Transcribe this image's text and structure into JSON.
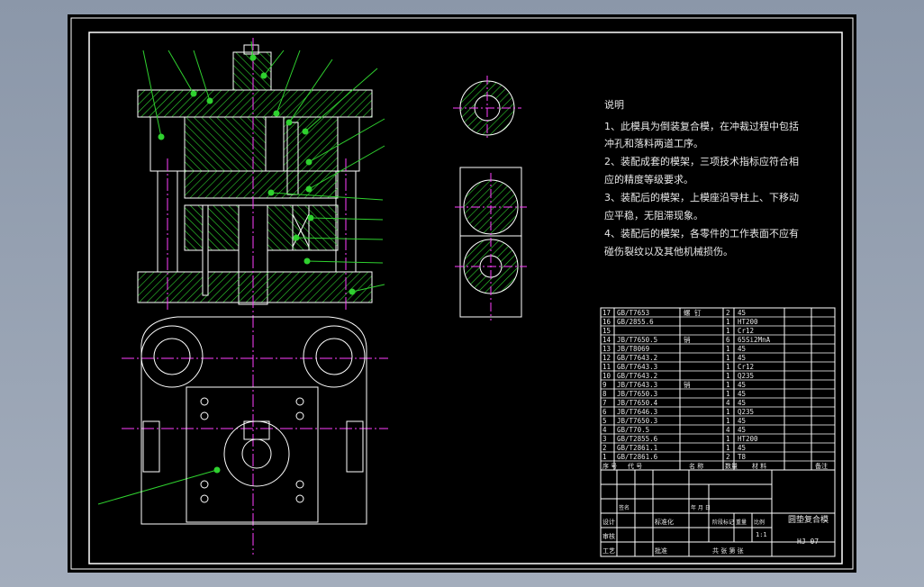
{
  "notes": {
    "heading": "说明",
    "lines": [
      "1、此模具为倒装复合模，在冲裁过程中包括",
      "冲孔和落料两道工序。",
      "2、装配成套的模架，三项技术指标应符合相",
      "应的精度等级要求。",
      "3、装配后的模架，上模座沿导柱上、下移动",
      "应平稳，无阻滞现象。",
      "4、装配后的模架，各零件的工作表面不应有",
      "碰伤裂纹以及其他机械损伤。"
    ]
  },
  "bom": {
    "rows": [
      {
        "no": "17",
        "code": "GB/T7653",
        "name": "螺 钉",
        "qty": "2",
        "mat": "45"
      },
      {
        "no": "16",
        "code": "GB/2855.6",
        "name": "",
        "qty": "1",
        "mat": "HT200"
      },
      {
        "no": "15",
        "code": "",
        "name": "",
        "qty": "1",
        "mat": "Cr12"
      },
      {
        "no": "14",
        "code": "JB/T7650.5",
        "name": "销",
        "qty": "6",
        "mat": "65Si2MnA"
      },
      {
        "no": "13",
        "code": "JB/T8069",
        "name": "",
        "qty": "1",
        "mat": "45"
      },
      {
        "no": "12",
        "code": "GB/T7643.2",
        "name": "",
        "qty": "1",
        "mat": "45"
      },
      {
        "no": "11",
        "code": "GB/T7643.3",
        "name": "",
        "qty": "1",
        "mat": "Cr12"
      },
      {
        "no": "10",
        "code": "GB/T7643.2",
        "name": "",
        "qty": "1",
        "mat": "Q235"
      },
      {
        "no": "9",
        "code": "JB/T7643.3",
        "name": "销",
        "qty": "1",
        "mat": "45"
      },
      {
        "no": "8",
        "code": "JB/T7650.3",
        "name": "",
        "qty": "1",
        "mat": "45"
      },
      {
        "no": "7",
        "code": "JB/T7650.4",
        "name": "",
        "qty": "4",
        "mat": "45"
      },
      {
        "no": "6",
        "code": "JB/T7646.3",
        "name": "",
        "qty": "1",
        "mat": "Q235"
      },
      {
        "no": "5",
        "code": "JB/T7650.3",
        "name": "",
        "qty": "1",
        "mat": "45"
      },
      {
        "no": "4",
        "code": "GB/T70.5",
        "name": "",
        "qty": "4",
        "mat": "45"
      },
      {
        "no": "3",
        "code": "GB/T2855.6",
        "name": "",
        "qty": "1",
        "mat": "HT200"
      },
      {
        "no": "2",
        "code": "GB/T2861.1",
        "name": "",
        "qty": "1",
        "mat": "45"
      },
      {
        "no": "1",
        "code": "GB/T2861.6",
        "name": "",
        "qty": "2",
        "mat": "T8"
      }
    ],
    "header": {
      "no": "序 号",
      "code": "代 号",
      "name": "名 称",
      "qty": "数量",
      "mat": "材 料",
      "remark": "备注"
    }
  },
  "title_block": {
    "drawing_name": "圆垫复合模",
    "drawing_no": "HJ-07",
    "designer_label": "设计",
    "check_label": "审核",
    "process_label": "工艺",
    "approve_label": "批准",
    "stage_label": "阶段标记",
    "weight_label": "重量",
    "scale_label": "比例",
    "scale_value": "1:1",
    "sheets_label": "共 张  第 张",
    "std_label": "标准化",
    "sign_label": "签名",
    "date_label": "年 月 日"
  },
  "colors": {
    "line": "#ffffff",
    "hatch": "#2fd12f",
    "center": "#ff40ff",
    "leader": "#2fd12f"
  }
}
